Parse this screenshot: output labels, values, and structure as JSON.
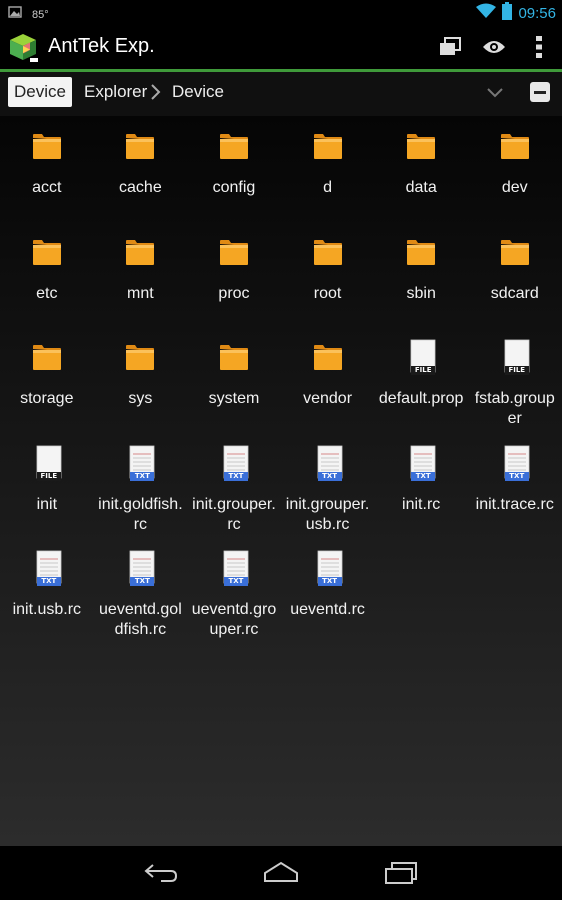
{
  "status_bar": {
    "temperature": "85°",
    "time": "09:56",
    "time_color": "#33b5e5"
  },
  "action_bar": {
    "app_title": "AntTek Exp.",
    "accent": "#3f9a3a",
    "icons": [
      "windows-icon",
      "eye-icon",
      "overflow-menu-icon"
    ]
  },
  "breadcrumb": {
    "root_button": "Device",
    "items": [
      "Explorer",
      "Device"
    ]
  },
  "files": [
    {
      "name": "acct",
      "type": "folder"
    },
    {
      "name": "cache",
      "type": "folder"
    },
    {
      "name": "config",
      "type": "folder"
    },
    {
      "name": "d",
      "type": "folder"
    },
    {
      "name": "data",
      "type": "folder"
    },
    {
      "name": "dev",
      "type": "folder"
    },
    {
      "name": "etc",
      "type": "folder"
    },
    {
      "name": "mnt",
      "type": "folder"
    },
    {
      "name": "proc",
      "type": "folder"
    },
    {
      "name": "root",
      "type": "folder"
    },
    {
      "name": "sbin",
      "type": "folder"
    },
    {
      "name": "sdcard",
      "type": "folder"
    },
    {
      "name": "storage",
      "type": "folder"
    },
    {
      "name": "sys",
      "type": "folder"
    },
    {
      "name": "system",
      "type": "folder"
    },
    {
      "name": "vendor",
      "type": "folder"
    },
    {
      "name": "default.prop",
      "type": "file",
      "badge": "FILE"
    },
    {
      "name": "fstab.grouper",
      "type": "file",
      "badge": "FILE"
    },
    {
      "name": "init",
      "type": "file",
      "badge": "FILE"
    },
    {
      "name": "init.goldfish.rc",
      "type": "txt",
      "badge": "TXT"
    },
    {
      "name": "init.grouper.rc",
      "type": "txt",
      "badge": "TXT"
    },
    {
      "name": "init.grouper.usb.rc",
      "type": "txt",
      "badge": "TXT"
    },
    {
      "name": "init.rc",
      "type": "txt",
      "badge": "TXT"
    },
    {
      "name": "init.trace.rc",
      "type": "txt",
      "badge": "TXT"
    },
    {
      "name": "init.usb.rc",
      "type": "txt",
      "badge": "TXT"
    },
    {
      "name": "ueventd.goldfish.rc",
      "type": "txt",
      "badge": "TXT"
    },
    {
      "name": "ueventd.grouper.rc",
      "type": "txt",
      "badge": "TXT"
    },
    {
      "name": "ueventd.rc",
      "type": "txt",
      "badge": "TXT"
    }
  ],
  "nav_bar": {
    "icons": [
      "back-icon",
      "home-icon",
      "recent-apps-icon"
    ]
  }
}
